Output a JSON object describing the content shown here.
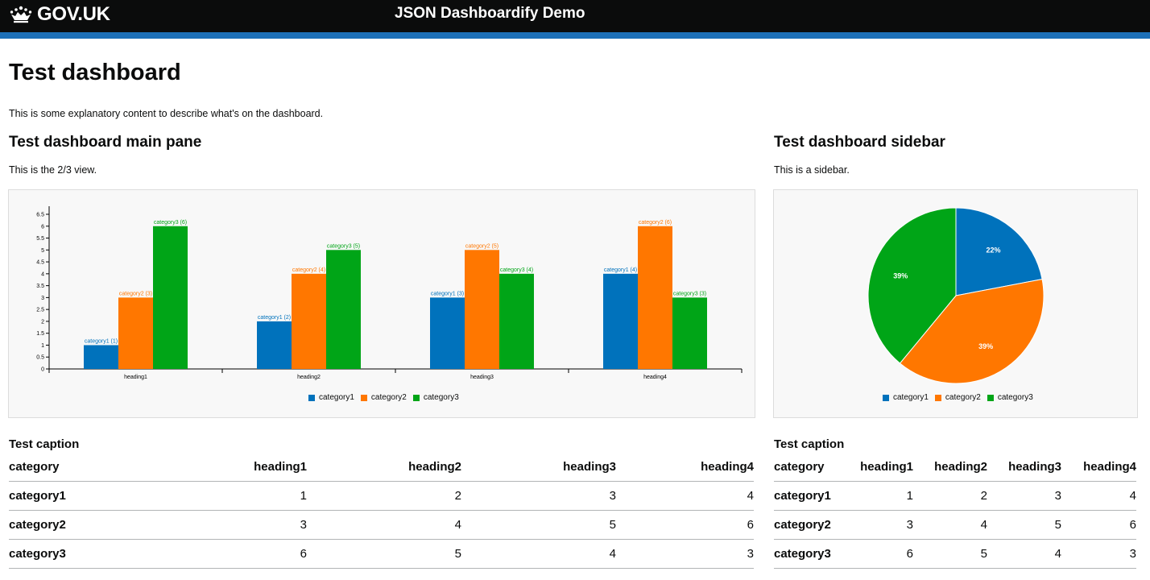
{
  "header": {
    "logo_text": "GOV.UK",
    "service_name": "JSON Dashboardify Demo"
  },
  "page": {
    "title": "Test dashboard",
    "intro": "This is some explanatory content to describe what's on the dashboard."
  },
  "main": {
    "title": "Test dashboard main pane",
    "description": "This is the 2/3 view."
  },
  "sidebar": {
    "title": "Test dashboard sidebar",
    "description": "This is a sidebar."
  },
  "colors": {
    "category1": "#0072bc",
    "category2": "#ff7700",
    "category3": "#00a517",
    "stripe": "#1d70b8"
  },
  "chart_data": [
    {
      "type": "bar",
      "categories": [
        "heading1",
        "heading2",
        "heading3",
        "heading4"
      ],
      "series": [
        {
          "name": "category1",
          "values": [
            1,
            2,
            3,
            4
          ]
        },
        {
          "name": "category2",
          "values": [
            3,
            4,
            5,
            6
          ]
        },
        {
          "name": "category3",
          "values": [
            6,
            5,
            4,
            3
          ]
        }
      ],
      "ylim": [
        0,
        6.5
      ],
      "yticks": [
        "0",
        "0.5",
        "1",
        "1.5",
        "2",
        "2.5",
        "3",
        "3.5",
        "4",
        "4.5",
        "5",
        "5.5",
        "6",
        "6.5"
      ],
      "legend": "bottom"
    },
    {
      "type": "pie",
      "labels": [
        "category1",
        "category2",
        "category3"
      ],
      "values": [
        22,
        39,
        39
      ],
      "value_labels": [
        "22%",
        "39%",
        "39%"
      ],
      "legend": "bottom"
    }
  ],
  "tables": {
    "main": {
      "caption": "Test caption",
      "headers": [
        "category",
        "heading1",
        "heading2",
        "heading3",
        "heading4"
      ],
      "rows": [
        [
          "category1",
          "1",
          "2",
          "3",
          "4"
        ],
        [
          "category2",
          "3",
          "4",
          "5",
          "6"
        ],
        [
          "category3",
          "6",
          "5",
          "4",
          "3"
        ]
      ]
    },
    "sidebar": {
      "caption": "Test caption",
      "headers": [
        "category",
        "heading1",
        "heading2",
        "heading3",
        "heading4"
      ],
      "rows": [
        [
          "category1",
          "1",
          "2",
          "3",
          "4"
        ],
        [
          "category2",
          "3",
          "4",
          "5",
          "6"
        ],
        [
          "category3",
          "6",
          "5",
          "4",
          "3"
        ]
      ]
    }
  }
}
